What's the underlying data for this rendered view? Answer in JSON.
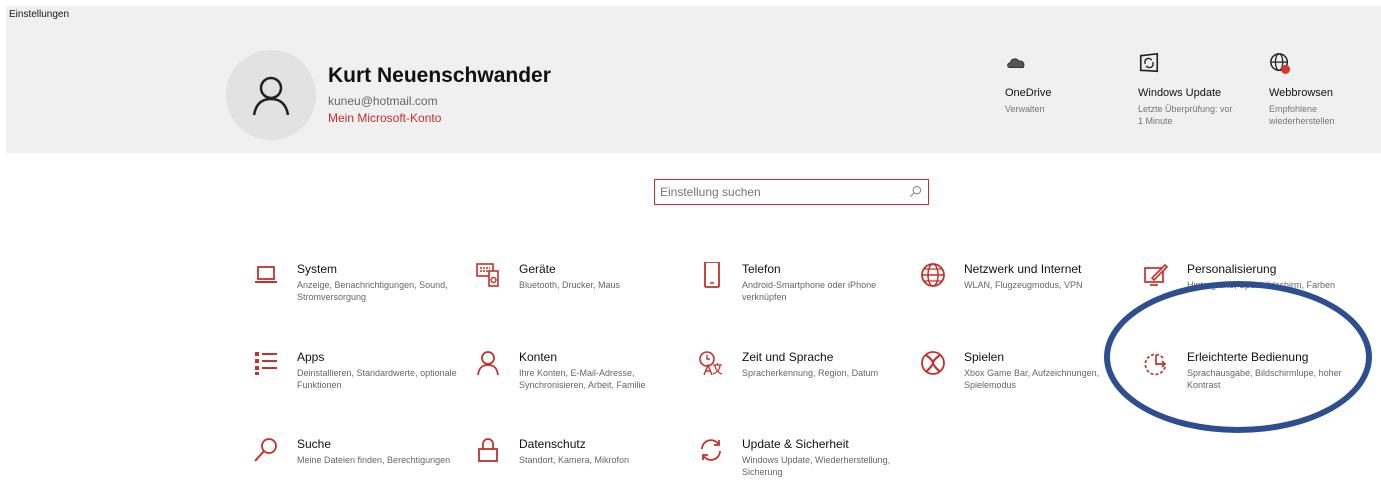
{
  "window": {
    "title": "Einstellungen"
  },
  "account": {
    "name": "Kurt Neuenschwander",
    "email": "kuneu@hotmail.com",
    "link": "Mein Microsoft-Konto"
  },
  "quick_actions": [
    {
      "title": "OneDrive",
      "sub": "Verwalten",
      "icon": "cloud-icon"
    },
    {
      "title": "Windows Update",
      "sub": "Letzte Überprüfung: vor 1 Minute",
      "icon": "windows-update-icon"
    },
    {
      "title": "Webbrowsen",
      "sub": "Empfohlene wiederherstellen",
      "icon": "globe-icon"
    }
  ],
  "search": {
    "placeholder": "Einstellung suchen"
  },
  "tiles": [
    {
      "title": "System",
      "desc": "Anzeige, Benachrichtigungen, Sound, Stromversorgung",
      "icon": "laptop-icon"
    },
    {
      "title": "Geräte",
      "desc": "Bluetooth, Drucker, Maus",
      "icon": "devices-icon"
    },
    {
      "title": "Telefon",
      "desc": "Android-Smartphone oder iPhone verknüpfen",
      "icon": "phone-icon"
    },
    {
      "title": "Netzwerk und Internet",
      "desc": "WLAN, Flugzeugmodus, VPN",
      "icon": "globe-icon"
    },
    {
      "title": "Personalisierung",
      "desc": "Hintergrund, Sperrbildschirm, Farben",
      "icon": "personalization-icon"
    },
    {
      "title": "Apps",
      "desc": "Deinstallieren, Standardwerte, optionale Funktionen",
      "icon": "apps-list-icon"
    },
    {
      "title": "Konten",
      "desc": "Ihre Konten, E-Mail-Adresse, Synchronisieren, Arbeit, Familie",
      "icon": "person-icon"
    },
    {
      "title": "Zeit und Sprache",
      "desc": "Spracherkennung, Region, Datum",
      "icon": "time-language-icon"
    },
    {
      "title": "Spielen",
      "desc": "Xbox Game Bar, Aufzeichnungen, Spielemodus",
      "icon": "xbox-icon"
    },
    {
      "title": "Erleichterte Bedienung",
      "desc": "Sprachausgabe, Bildschirmlupe, hoher Kontrast",
      "icon": "ease-of-access-icon"
    },
    {
      "title": "Suche",
      "desc": "Meine Dateien finden, Berechtigungen",
      "icon": "search-icon"
    },
    {
      "title": "Datenschutz",
      "desc": "Standort, Kamera, Mikrofon",
      "icon": "lock-icon"
    },
    {
      "title": "Update & Sicherheit",
      "desc": "Windows Update, Wiederherstellung, Sicherung",
      "icon": "sync-icon"
    }
  ],
  "colors": {
    "accent": "#c4302b",
    "annotation": "#2e4e92",
    "header_bg": "#f0f0f0"
  }
}
